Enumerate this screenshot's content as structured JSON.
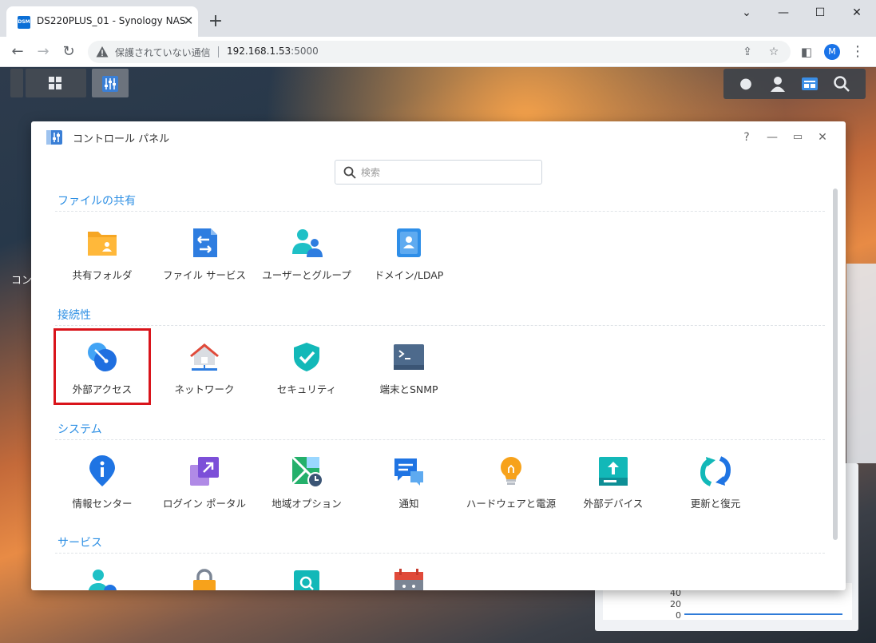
{
  "browser": {
    "tab_favicon_text": "DSM",
    "tab_title": "DS220PLUS_01 - Synology NAS",
    "tab_close": "✕",
    "new_tab": "+",
    "security_label": "保護されていない通信",
    "url_host": "192.168.1.53",
    "url_port": ":5000",
    "profile_initial": "M"
  },
  "desktop": {
    "partial_label": "コン",
    "perf_axis": [
      "40",
      "20",
      "0"
    ]
  },
  "control_panel": {
    "title": "コントロール パネル",
    "help": "?",
    "search_placeholder": "検索",
    "sections": [
      {
        "title": "ファイルの共有",
        "items": [
          {
            "label": "共有フォルダ",
            "icon": "shared-folder-icon"
          },
          {
            "label": "ファイル サービス",
            "icon": "file-services-icon"
          },
          {
            "label": "ユーザーとグループ",
            "icon": "users-groups-icon"
          },
          {
            "label": "ドメイン/LDAP",
            "icon": "domain-ldap-icon"
          }
        ]
      },
      {
        "title": "接続性",
        "items": [
          {
            "label": "外部アクセス",
            "icon": "external-access-icon"
          },
          {
            "label": "ネットワーク",
            "icon": "network-icon"
          },
          {
            "label": "セキュリティ",
            "icon": "security-icon"
          },
          {
            "label": "端末とSNMP",
            "icon": "terminal-snmp-icon"
          }
        ]
      },
      {
        "title": "システム",
        "items": [
          {
            "label": "情報センター",
            "icon": "info-center-icon"
          },
          {
            "label": "ログイン ポータル",
            "icon": "login-portal-icon"
          },
          {
            "label": "地域オプション",
            "icon": "regional-options-icon"
          },
          {
            "label": "通知",
            "icon": "notification-icon"
          },
          {
            "label": "ハードウェアと電源",
            "icon": "hardware-power-icon"
          },
          {
            "label": "外部デバイス",
            "icon": "external-devices-icon"
          },
          {
            "label": "更新と復元",
            "icon": "update-restore-icon"
          }
        ]
      },
      {
        "title": "サービス",
        "items": []
      }
    ]
  }
}
